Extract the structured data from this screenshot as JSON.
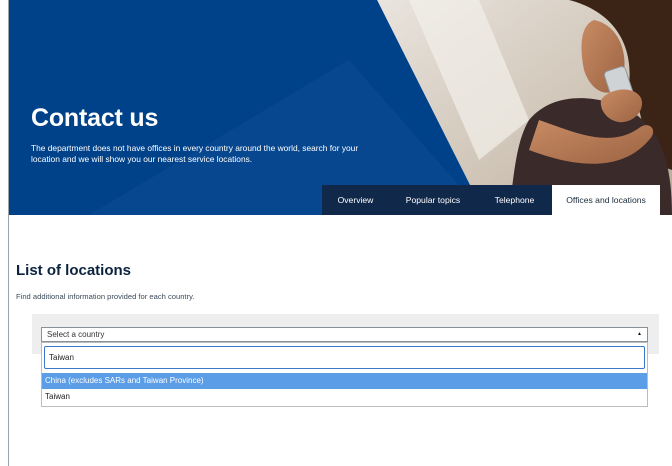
{
  "hero": {
    "title": "Contact us",
    "description": "The department does not have offices in every country around the world, search for your location and we will show you our nearest service locations."
  },
  "tabs": [
    {
      "label": "Overview",
      "active": false
    },
    {
      "label": "Popular topics",
      "active": false
    },
    {
      "label": "Telephone",
      "active": false
    },
    {
      "label": "Offices and locations",
      "active": true
    }
  ],
  "locations": {
    "title": "List of locations",
    "subtitle": "Find additional information provided for each country.",
    "select_placeholder": "Select a country",
    "search_value": "Taiwan",
    "options": [
      {
        "label": "China (excludes SARs and Taiwan Province)",
        "highlighted": true
      },
      {
        "label": "Taiwan",
        "highlighted": false
      }
    ]
  },
  "colors": {
    "hero_blue": "#00428a",
    "tab_navy": "#10284a",
    "highlight_blue": "#5b9de7"
  }
}
